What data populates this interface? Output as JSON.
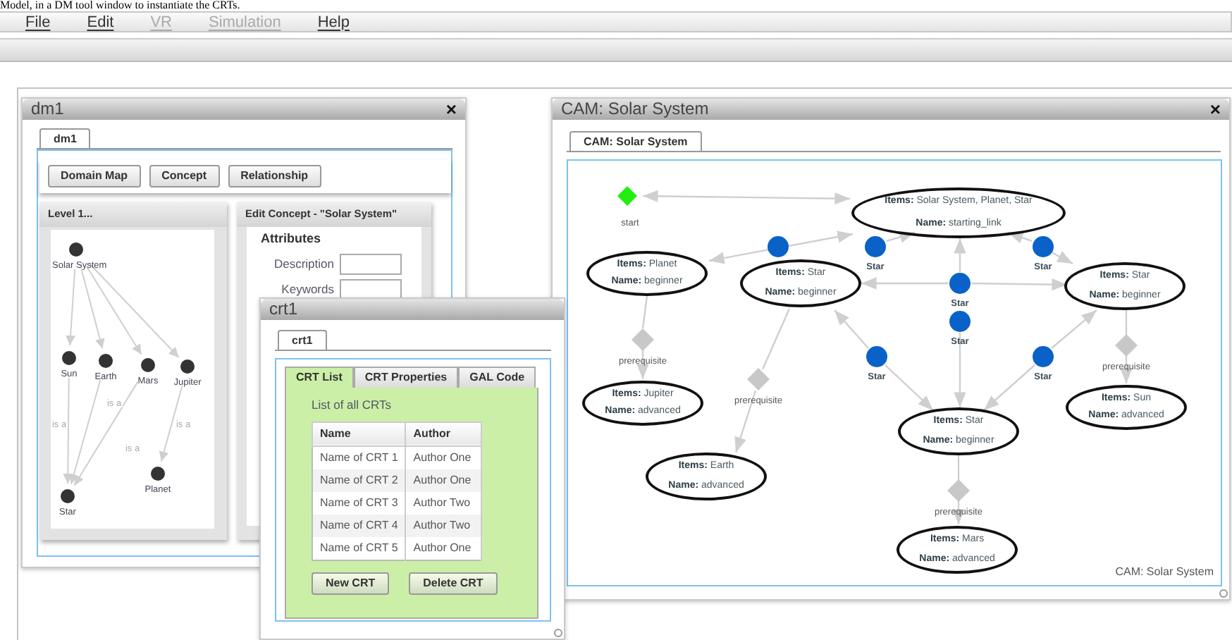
{
  "document_text": "Model, in a DM tool window to instantiate the CRTs.",
  "menu": [
    {
      "label": "File",
      "disabled": false
    },
    {
      "label": "Edit",
      "disabled": false
    },
    {
      "label": "VR",
      "disabled": true
    },
    {
      "label": "Simulation",
      "disabled": true
    },
    {
      "label": "Help",
      "disabled": false
    }
  ],
  "dm_window": {
    "title": "dm1",
    "close": "×",
    "tabs": [
      {
        "label": "dm1",
        "selected": true
      }
    ],
    "toolbar": [
      "Domain Map",
      "Concept",
      "Relationship"
    ],
    "level_panel": {
      "title": "Level 1...",
      "nodes": [
        "Solar System",
        "Sun",
        "Earth",
        "Mars",
        "Jupiter",
        "Planet",
        "Star"
      ],
      "edge_labels": [
        "is a",
        "is a",
        "is a",
        "is a"
      ]
    },
    "edit_panel": {
      "title": "Edit Concept - \"Solar System\"",
      "section": "Attributes",
      "fields": [
        {
          "label": "Description"
        },
        {
          "label": "Keywords"
        }
      ]
    }
  },
  "crt_window": {
    "title": "crt1",
    "tabs": [
      {
        "label": "crt1",
        "selected": true
      }
    ],
    "inner_tabs": [
      {
        "label": "CRT List",
        "selected": true
      },
      {
        "label": "CRT Properties",
        "selected": false
      },
      {
        "label": "GAL Code",
        "selected": false
      }
    ],
    "caption": "List of all CRTs",
    "table": {
      "columns": [
        "Name",
        "Author"
      ],
      "rows": [
        [
          "Name of CRT 1",
          "Author One"
        ],
        [
          "Name of CRT 2",
          "Author One"
        ],
        [
          "Name of CRT 3",
          "Author Two"
        ],
        [
          "Name of CRT 4",
          "Author Two"
        ],
        [
          "Name of CRT 5",
          "Author One"
        ]
      ]
    },
    "buttons": [
      "New CRT",
      "Delete CRT"
    ]
  },
  "cam_window": {
    "title": "CAM: Solar System",
    "close": "×",
    "tabs": [
      {
        "label": "CAM: Solar System",
        "selected": true
      }
    ],
    "start_label": "start",
    "concepts": [
      {
        "items": "**Items:** Solar System, Planet, Star",
        "name": "**Name:** starting_link"
      },
      {
        "items": "**Items:** Planet",
        "name": "**Name:** beginner"
      },
      {
        "items": "**Items:** Star",
        "name": "**Name:** beginner"
      },
      {
        "items": "**Items:** Star",
        "name": "**Name:** beginner"
      },
      {
        "items": "**Items:** Jupiter",
        "name": "**Name:** advanced"
      },
      {
        "items": "**Items:** Earth",
        "name": "**Name:** advanced"
      },
      {
        "items": "**Items:** Star",
        "name": "**Name:** beginner"
      },
      {
        "items": "**Items:** Sun",
        "name": "**Name:** advanced"
      },
      {
        "items": "**Items:** Mars",
        "name": "**Name:** advanced"
      }
    ],
    "star_labels": [
      "Star",
      "Star",
      "Star",
      "Star",
      "Star",
      "Star"
    ],
    "prerequisite_labels": [
      "prerequisite",
      "prerequisite",
      "prerequisite",
      "prerequisite"
    ],
    "footer": "CAM: Solar System"
  }
}
